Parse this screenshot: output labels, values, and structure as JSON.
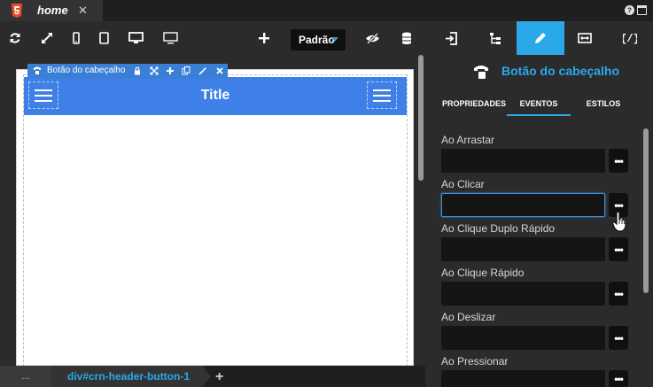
{
  "tab": {
    "title": "home",
    "close": "✕"
  },
  "toolbar": {
    "icons": [
      "refresh-icon",
      "expand-icon",
      "phone-icon",
      "tablet-icon",
      "desktop-icon",
      "monitor-icon",
      "plus-icon",
      "eye-slash-icon",
      "database-icon"
    ],
    "theme_select": "Padrão"
  },
  "selection": {
    "label": "Botão do cabeçalho"
  },
  "header": {
    "title": "Title"
  },
  "statusbar": {
    "crumb_dots": "...",
    "crumb_path": "div#crn-header-button-1",
    "add": "+"
  },
  "panel": {
    "tabs": [
      "enter-icon",
      "hierarchy-icon",
      "pencil-icon",
      "arrows-icon",
      "code-icon"
    ],
    "component_title": "Botão do cabeçalho",
    "subtabs": [
      "PROPRIEDADES",
      "EVENTOS",
      "ESTILOS"
    ],
    "events": [
      {
        "label": "Ao Arrastar"
      },
      {
        "label": "Ao Clicar"
      },
      {
        "label": "Ao Clique Duplo Rápido"
      },
      {
        "label": "Ao Clique Rápido"
      },
      {
        "label": "Ao Deslizar"
      },
      {
        "label": "Ao Pressionar"
      }
    ],
    "more_label": "•••"
  },
  "colors": {
    "accent": "#2aa8ea",
    "header": "#3f7fe8",
    "bg": "#2b2b2b"
  }
}
